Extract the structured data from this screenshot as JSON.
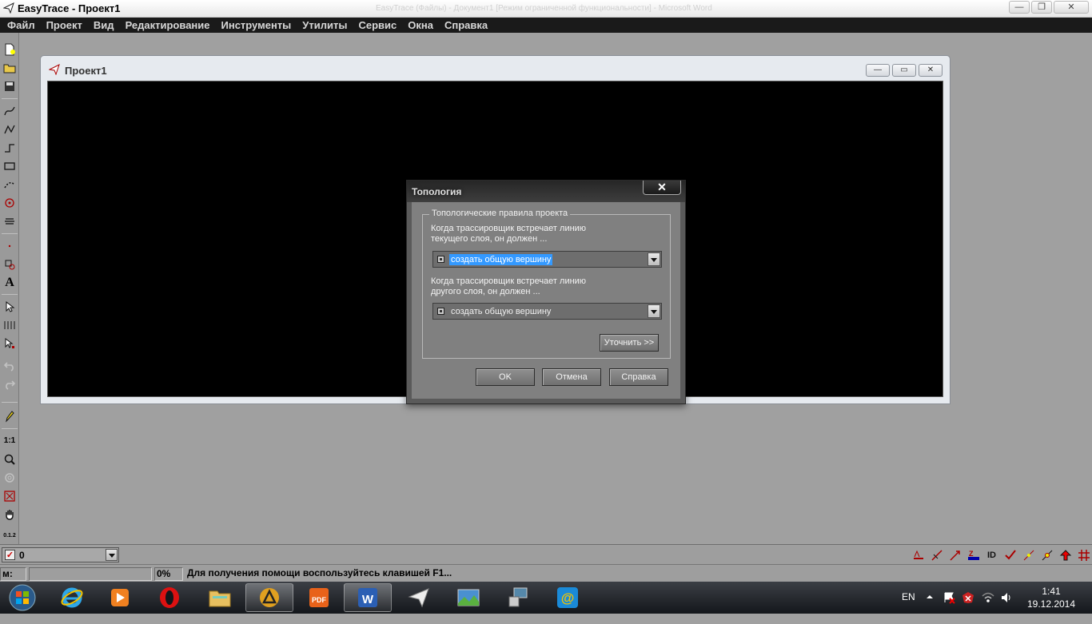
{
  "window": {
    "title": "EasyTrace - Проект1",
    "ghost_text": "EasyTrace (Файлы) - Документ1 [Режим ограниченной функциональности] - Microsoft Word",
    "controls": [
      "—",
      "❐",
      "✕"
    ]
  },
  "menu": [
    "Файл",
    "Проект",
    "Вид",
    "Редактирование",
    "Инструменты",
    "Утилиты",
    "Сервис",
    "Окна",
    "Справка"
  ],
  "left_toolbar": {
    "scale_label": "1:1",
    "text_tool_label": "A",
    "coords_label": "0.1.2"
  },
  "project_window": {
    "title": "Проект1",
    "controls": [
      "—",
      "▭",
      "✕"
    ]
  },
  "dialog": {
    "title": "Топология",
    "close_label": "✕",
    "group_label": "Топологические правила проекта",
    "rule1_line1": "Когда трассировщик встречает линию",
    "rule1_line2": "текущего слоя, он должен ...",
    "rule1_value": "создать общую вершину",
    "rule2_line1": "Когда трассировщик встречает линию",
    "rule2_line2": "другого слоя, он должен ...",
    "rule2_value": "создать общую вершину",
    "refine_button": "Уточнить >>",
    "ok_button": "OK",
    "cancel_button": "Отмена",
    "help_button": "Справка"
  },
  "layer_bar": {
    "layer_value": "0",
    "check_mark": "✓",
    "id_label": "ID"
  },
  "status_bar": {
    "mode_label": "м:",
    "percent": "0%",
    "hint": "Для получения помощи воспользуйтесь клавишей F1..."
  },
  "taskbar": {
    "language": "EN",
    "time": "1:41",
    "date": "19.12.2014",
    "pdf_label": "PDF",
    "word_label": "W"
  },
  "colors": {
    "canvas": "#000000",
    "selection": "#3399ff",
    "menubar": "#1a1a1a"
  }
}
